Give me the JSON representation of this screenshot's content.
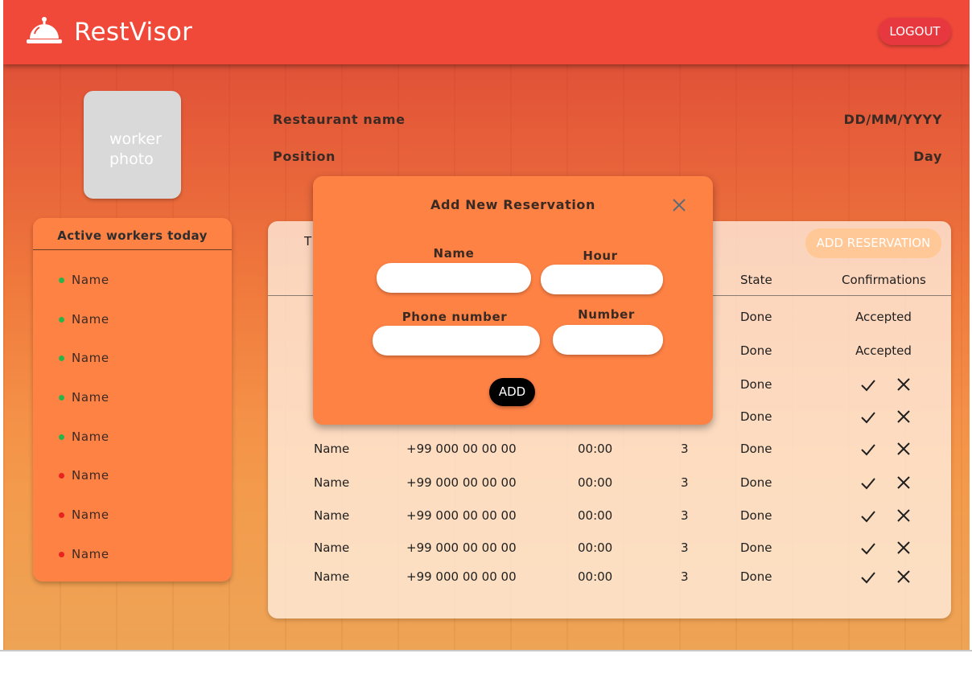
{
  "header": {
    "brand": "RestVisor",
    "logout_label": "LOGOUT"
  },
  "profile": {
    "photo_label_line1": "worker",
    "photo_label_line2": "photo",
    "restaurant_name": "Restaurant name",
    "position": "Position",
    "date": "DD/MM/YYYY",
    "day": "Day"
  },
  "workers_panel": {
    "title": "Active workers today",
    "workers": [
      {
        "name": "Name",
        "status": "active"
      },
      {
        "name": "Name",
        "status": "active"
      },
      {
        "name": "Name",
        "status": "active"
      },
      {
        "name": "Name",
        "status": "active"
      },
      {
        "name": "Name",
        "status": "active"
      },
      {
        "name": "Name",
        "status": "inactive"
      },
      {
        "name": "Name",
        "status": "inactive"
      },
      {
        "name": "Name",
        "status": "inactive"
      }
    ]
  },
  "status_colors": {
    "active": "#2bb34a",
    "inactive": "#e8231f"
  },
  "reservations": {
    "title_fragment": "T",
    "add_button_label": "ADD RESERVATION",
    "columns": {
      "state": "State",
      "confirmations": "Confirmations"
    },
    "rows": [
      {
        "name": "",
        "phone": "",
        "hour": "",
        "count": "",
        "state": "Done",
        "confirmation": "Accepted",
        "actions": false
      },
      {
        "name": "",
        "phone": "",
        "hour": "",
        "count": "",
        "state": "Done",
        "confirmation": "Accepted",
        "actions": false
      },
      {
        "name": "",
        "phone": "",
        "hour": "",
        "count": "",
        "state": "Done",
        "confirmation": "",
        "actions": true
      },
      {
        "name": "",
        "phone": "",
        "hour": "",
        "count": "",
        "state": "Done",
        "confirmation": "",
        "actions": true
      },
      {
        "name": "Name",
        "phone": "+99 000 00 00 00",
        "hour": "00:00",
        "count": "3",
        "state": "Done",
        "confirmation": "",
        "actions": true
      },
      {
        "name": "Name",
        "phone": "+99 000 00 00 00",
        "hour": "00:00",
        "count": "3",
        "state": "Done",
        "confirmation": "",
        "actions": true
      },
      {
        "name": "Name",
        "phone": "+99 000 00 00 00",
        "hour": "00:00",
        "count": "3",
        "state": "Done",
        "confirmation": "",
        "actions": true
      },
      {
        "name": "Name",
        "phone": "+99 000 00 00 00",
        "hour": "00:00",
        "count": "3",
        "state": "Done",
        "confirmation": "",
        "actions": true
      },
      {
        "name": "Name",
        "phone": "+99 000 00 00 00",
        "hour": "00:00",
        "count": "3",
        "state": "Done",
        "confirmation": "",
        "actions": true
      }
    ]
  },
  "modal": {
    "title": "Add New Reservation",
    "labels": {
      "name": "Name",
      "hour": "Hour",
      "phone": "Phone number",
      "number": "Number"
    },
    "values": {
      "name": "",
      "hour": "",
      "phone": "",
      "number": ""
    },
    "add_label": "ADD"
  },
  "icons": {
    "logo": "service-bell-icon",
    "close": "close-icon",
    "accept": "check-icon",
    "reject": "x-icon"
  }
}
